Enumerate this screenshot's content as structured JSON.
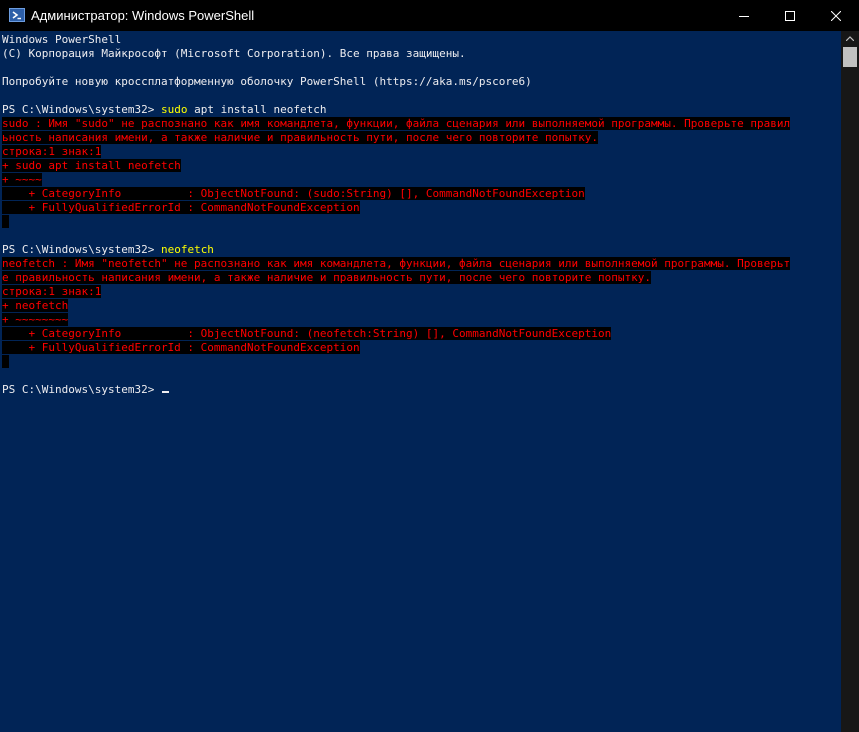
{
  "window": {
    "title": "Администратор: Windows PowerShell",
    "icon": "powershell-icon",
    "controls": [
      "minimize-icon",
      "maximize-icon",
      "close-icon"
    ]
  },
  "colors": {
    "console_bg": "#012456",
    "text": "#eeedf0",
    "error_text": "#ff0000",
    "error_bg": "#000000",
    "command": "#ffff00"
  },
  "console": {
    "lines": [
      {
        "type": "text",
        "text": "Windows PowerShell"
      },
      {
        "type": "text",
        "text": "(C) Корпорация Майкрософт (Microsoft Corporation). Все права защищены."
      },
      {
        "type": "blank",
        "text": ""
      },
      {
        "type": "text",
        "text": "Попробуйте новую кроссплатформенную оболочку PowerShell (https://aka.ms/pscore6)"
      },
      {
        "type": "blank",
        "text": ""
      },
      {
        "type": "prompt",
        "prompt": "PS C:\\Windows\\system32> ",
        "cmd": "sudo",
        "args": " apt install neofetch"
      },
      {
        "type": "error",
        "text": "sudo : Имя \"sudo\" не распознано как имя командлета, функции, файла сценария или выполняемой программы. Проверьте правил"
      },
      {
        "type": "error",
        "text": "ьность написания имени, а также наличие и правильность пути, после чего повторите попытку."
      },
      {
        "type": "error",
        "text": "строка:1 знак:1"
      },
      {
        "type": "error",
        "text": "+ sudo apt install neofetch"
      },
      {
        "type": "error",
        "text": "+ ~~~~"
      },
      {
        "type": "error",
        "text": "    + CategoryInfo          : ObjectNotFound: (sudo:String) [], CommandNotFoundException"
      },
      {
        "type": "error",
        "text": "    + FullyQualifiedErrorId : CommandNotFoundException"
      },
      {
        "type": "error-blank",
        "text": " "
      },
      {
        "type": "blank",
        "text": ""
      },
      {
        "type": "prompt",
        "prompt": "PS C:\\Windows\\system32> ",
        "cmd": "neofetch",
        "args": ""
      },
      {
        "type": "error",
        "text": "neofetch : Имя \"neofetch\" не распознано как имя командлета, функции, файла сценария или выполняемой программы. Проверьт"
      },
      {
        "type": "error",
        "text": "е правильность написания имени, а также наличие и правильность пути, после чего повторите попытку."
      },
      {
        "type": "error",
        "text": "строка:1 знак:1"
      },
      {
        "type": "error",
        "text": "+ neofetch"
      },
      {
        "type": "error",
        "text": "+ ~~~~~~~~"
      },
      {
        "type": "error",
        "text": "    + CategoryInfo          : ObjectNotFound: (neofetch:String) [], CommandNotFoundException"
      },
      {
        "type": "error",
        "text": "    + FullyQualifiedErrorId : CommandNotFoundException"
      },
      {
        "type": "error-blank",
        "text": " "
      },
      {
        "type": "blank",
        "text": ""
      },
      {
        "type": "current-prompt",
        "prompt": "PS C:\\Windows\\system32> "
      }
    ]
  }
}
